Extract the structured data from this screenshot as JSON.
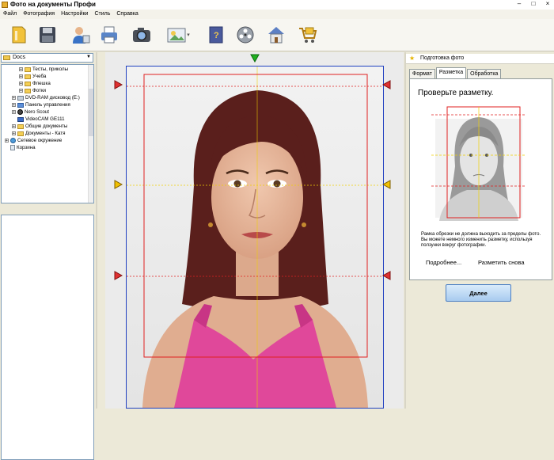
{
  "window": {
    "title": "Фото на документы Профи",
    "minimize": "–",
    "maximize": "□",
    "close": "×"
  },
  "menu": [
    "Файл",
    "Фотография",
    "Настройки",
    "Стиль",
    "Справка"
  ],
  "toolbar": {
    "icons": [
      "open-document-icon",
      "save-icon",
      "user-icon",
      "print-icon",
      "camera-icon",
      "image-menu-icon",
      "help-book-icon",
      "video-icon",
      "home-icon",
      "cart-icon"
    ],
    "image_menu_arrow": "▾"
  },
  "folder_combo": {
    "value": "Docs",
    "arrow": "▼"
  },
  "tree": [
    {
      "label": "Тесты, приколы",
      "icon": "folder",
      "indent": 3,
      "expander": "+"
    },
    {
      "label": "Учеба",
      "icon": "folder",
      "indent": 3,
      "expander": "+"
    },
    {
      "label": "Флешка",
      "icon": "folder",
      "indent": 3,
      "expander": "+"
    },
    {
      "label": "Фотки",
      "icon": "folder",
      "indent": 3,
      "expander": "+"
    },
    {
      "label": "DVD-RAM дисковод (E:)",
      "icon": "drive",
      "indent": 2,
      "expander": "+"
    },
    {
      "label": "Панель управления",
      "icon": "panel",
      "indent": 2,
      "expander": "+"
    },
    {
      "label": "Nero Scout",
      "icon": "nero",
      "indent": 2,
      "expander": "+"
    },
    {
      "label": "VideoCAM GE111",
      "icon": "cam",
      "indent": 2,
      "expander": ""
    },
    {
      "label": "Общие документы",
      "icon": "folder",
      "indent": 2,
      "expander": "+"
    },
    {
      "label": "Документы - Катя",
      "icon": "folder",
      "indent": 2,
      "expander": "+"
    },
    {
      "label": "Сетевое окружение",
      "icon": "net",
      "indent": 1,
      "expander": "+"
    },
    {
      "label": "Корзина",
      "icon": "bin",
      "indent": 1,
      "expander": ""
    }
  ],
  "right_panel": {
    "header": "Подготовка фото",
    "tabs": [
      "Формат",
      "Разметка",
      "Обработка"
    ],
    "active_tab": "Разметка",
    "heading": "Проверьте разметку.",
    "note": "Рамка обрезки не должна выходить за пределы фото. Вы можете немного изменить разметку, используя ползунки вокруг фотографии.",
    "link_more": "Подробнее...",
    "link_redo": "Разметить снова",
    "next_button": "Далее"
  },
  "colors": {
    "crop_frame": "#e02020",
    "eye_line": "#f0d000",
    "photo_border": "#2040c0",
    "marker_red": "#e03030",
    "marker_yellow": "#f0c000",
    "marker_green": "#20b020"
  }
}
